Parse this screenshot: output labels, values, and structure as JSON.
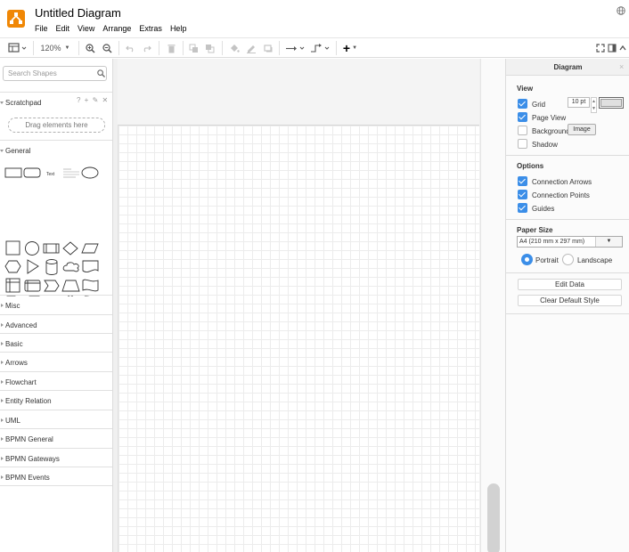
{
  "app": {
    "title": "Untitled Diagram",
    "menus": [
      "File",
      "Edit",
      "View",
      "Arrange",
      "Extras",
      "Help"
    ]
  },
  "toolbar": {
    "zoom": "120%",
    "add_symbol": "+"
  },
  "sidebar": {
    "search_placeholder": "Search Shapes",
    "scratchpad": {
      "label": "Scratchpad",
      "tools": "? + ✎ ✕",
      "drop_hint": "Drag elements here"
    },
    "general_label": "General",
    "text_shape_label": "Text",
    "collapsed": [
      "Misc",
      "Advanced",
      "Basic",
      "Arrows",
      "Flowchart",
      "Entity Relation",
      "UML",
      "BPMN General",
      "BPMN Gateways",
      "BPMN Events"
    ]
  },
  "format": {
    "title": "Diagram",
    "close": "×",
    "view": {
      "heading": "View",
      "grid": "Grid",
      "grid_size": "10 pt",
      "grid_checked": true,
      "page_view": "Page View",
      "page_view_checked": true,
      "background": "Background",
      "background_checked": false,
      "image_button": "Image",
      "shadow": "Shadow",
      "shadow_checked": false
    },
    "options": {
      "heading": "Options",
      "connection_arrows": "Connection Arrows",
      "connection_points": "Connection Points",
      "guides": "Guides"
    },
    "paper": {
      "heading": "Paper Size",
      "size": "A4 (210 mm x 297 mm)",
      "portrait": "Portrait",
      "landscape": "Landscape",
      "orientation": "portrait"
    },
    "buttons": {
      "edit_data": "Edit Data",
      "clear_style": "Clear Default Style"
    }
  },
  "colors": {
    "accent": "#f08705",
    "checkbox": "#3b8ee8",
    "grid": "#ececec",
    "canvas_bg": "#f0f0f0"
  }
}
